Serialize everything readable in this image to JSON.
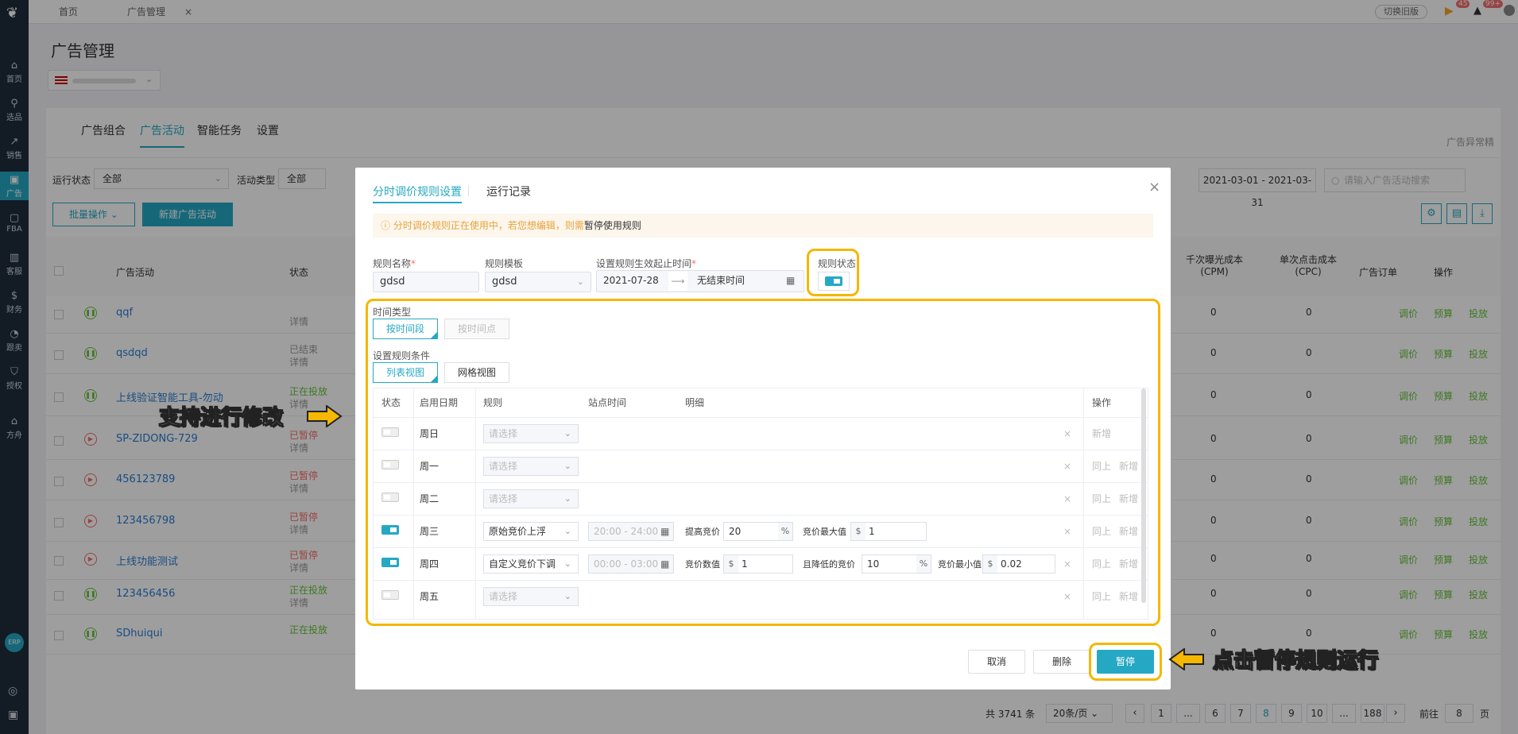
{
  "sidebar": {
    "items": [
      {
        "label": "首页",
        "icon": "home-icon"
      },
      {
        "label": "选品",
        "icon": "search-icon"
      },
      {
        "label": "销售",
        "icon": "chart-icon"
      },
      {
        "label": "广告",
        "icon": "ad-icon"
      },
      {
        "label": "FBA",
        "icon": "box-icon"
      },
      {
        "label": "客服",
        "icon": "service-icon"
      },
      {
        "label": "财务",
        "icon": "finance-icon"
      },
      {
        "label": "跟卖",
        "icon": "pie-icon"
      },
      {
        "label": "授权",
        "icon": "shield-icon"
      },
      {
        "label": "方舟",
        "icon": "ark-icon"
      }
    ],
    "erp": "ERP"
  },
  "topbar": {
    "tabs": [
      "首页",
      "广告管理"
    ],
    "switch_label": "切换旧版",
    "badge1": "45",
    "badge2": "99+"
  },
  "page": {
    "title": "广告管理",
    "subtabs": [
      "广告组合",
      "广告活动",
      "智能任务",
      "设置"
    ],
    "anomaly": "广告异常精",
    "filter_run_label": "运行状态",
    "filter_run_value": "全部",
    "filter_type_label": "活动类型",
    "filter_type_value": "全部",
    "batch_btn": "批量操作",
    "new_btn": "新建广告活动",
    "date_range": "2021-03-01  -  2021-03-31",
    "search_placeholder": "请输入广告活动搜索",
    "cols": {
      "campaign": "广告活动",
      "status": "状态",
      "cpm": "千次曝光成本",
      "cpm_sub": "(CPM)",
      "cpc": "单次点击成本",
      "cpc_sub": "(CPC)",
      "order": "广告订单",
      "ops": "操作"
    },
    "rows": [
      {
        "name": "qqf",
        "status": "",
        "detail": "详情",
        "cpm": "0",
        "cpc": "0",
        "icon": "pause"
      },
      {
        "name": "qsdqd",
        "status": "已结束",
        "detail": "详情",
        "cpm": "0",
        "cpc": "0",
        "icon": "pause"
      },
      {
        "name": "上线验证智能工具-勿动",
        "status": "正在投放",
        "detail": "详情",
        "cpm": "0",
        "cpc": "0",
        "icon": "pause"
      },
      {
        "name": "SP-ZIDONG-729",
        "status": "已暂停",
        "detail": "详情",
        "cpm": "0",
        "cpc": "0",
        "icon": "play"
      },
      {
        "name": "456123789",
        "status": "已暂停",
        "detail": "详情",
        "cpm": "0",
        "cpc": "0",
        "icon": "play"
      },
      {
        "name": "123456798",
        "status": "已暂停",
        "detail": "详情",
        "cpm": "0",
        "cpc": "0",
        "icon": "play"
      },
      {
        "name": "上线功能测试",
        "status": "已暂停",
        "detail": "详情",
        "cpm": "0",
        "cpc": "0",
        "icon": "play"
      },
      {
        "name": "123456456",
        "status": "正在投放",
        "detail": "详情",
        "cpm": "0",
        "cpc": "0",
        "icon": "pause"
      },
      {
        "name": "SDhuiqui",
        "status": "正在投放",
        "detail": "",
        "cpm": "0",
        "cpc": "0",
        "icon": "pause"
      }
    ],
    "op_labels": [
      "调价",
      "预算",
      "投放"
    ],
    "pagination": {
      "total": "共 3741 条",
      "per_page": "20条/页",
      "pages": [
        "1",
        "...",
        "6",
        "7",
        "8",
        "9",
        "10",
        "...",
        "188"
      ],
      "goto_label": "前往",
      "goto_value": "8",
      "page_suffix": "页"
    }
  },
  "modal": {
    "tab_active": "分时调价规则设置",
    "tab_other": "运行记录",
    "warning": "分时调价规则正在使用中，若您想编辑，则需",
    "warning_link": "暂停使用规则",
    "name_label": "规则名称",
    "name_value": "gdsd",
    "template_label": "规则模板",
    "template_value": "gdsd",
    "period_label": "设置规则生效起止时间",
    "start_date": "2021-07-28",
    "end_date": "无结束时间",
    "rule_status_label": "规则状态",
    "time_type_label": "时间类型",
    "time_type_options": [
      "按时间段",
      "按时间点"
    ],
    "cond_label": "设置规则条件",
    "view_options": [
      "列表视图",
      "网格视图"
    ],
    "table_headers": {
      "status": "状态",
      "day": "启用日期",
      "rule": "规则",
      "time": "站点时间",
      "detail": "明细",
      "ops": "操作"
    },
    "rows": [
      {
        "day": "周日",
        "on": false,
        "rule": "请选择",
        "time": "",
        "ops": [
          "新增"
        ]
      },
      {
        "day": "周一",
        "on": false,
        "rule": "请选择",
        "time": "",
        "ops": [
          "同上",
          "新增"
        ]
      },
      {
        "day": "周二",
        "on": false,
        "rule": "请选择",
        "time": "",
        "ops": [
          "同上",
          "新增"
        ]
      },
      {
        "day": "周三",
        "on": true,
        "rule": "原始竞价上浮",
        "time": "20:00 - 24:00",
        "d1_label": "提高竞价",
        "d1_value": "20",
        "d1_unit": "%",
        "d2_label": "竞价最大值",
        "d2_unit": "$",
        "d2_value": "1",
        "ops": [
          "同上",
          "新增"
        ]
      },
      {
        "day": "周四",
        "on": true,
        "rule": "自定义竞价下调",
        "time": "00:00 - 03:00",
        "d1_label": "竞价数值",
        "d1_unit": "$",
        "d1_value": "1",
        "d2_label": "且降低的竞价",
        "d2_value": "10",
        "d2_unit": "%",
        "d3_label": "竞价最小值",
        "d3_unit": "$",
        "d3_value": "0.02",
        "ops": [
          "同上",
          "新增"
        ]
      },
      {
        "day": "周五",
        "on": false,
        "rule": "请选择",
        "time": "",
        "ops": [
          "同上",
          "新增"
        ]
      }
    ],
    "btn_cancel": "取消",
    "btn_delete": "删除",
    "btn_pause": "暂停"
  },
  "callouts": {
    "left": "支持进行修改",
    "right": "点击暂停规则运行"
  },
  "colors": {
    "accent": "#25a8c4",
    "highlight": "#f5b700",
    "warn": "#e6a23c"
  }
}
